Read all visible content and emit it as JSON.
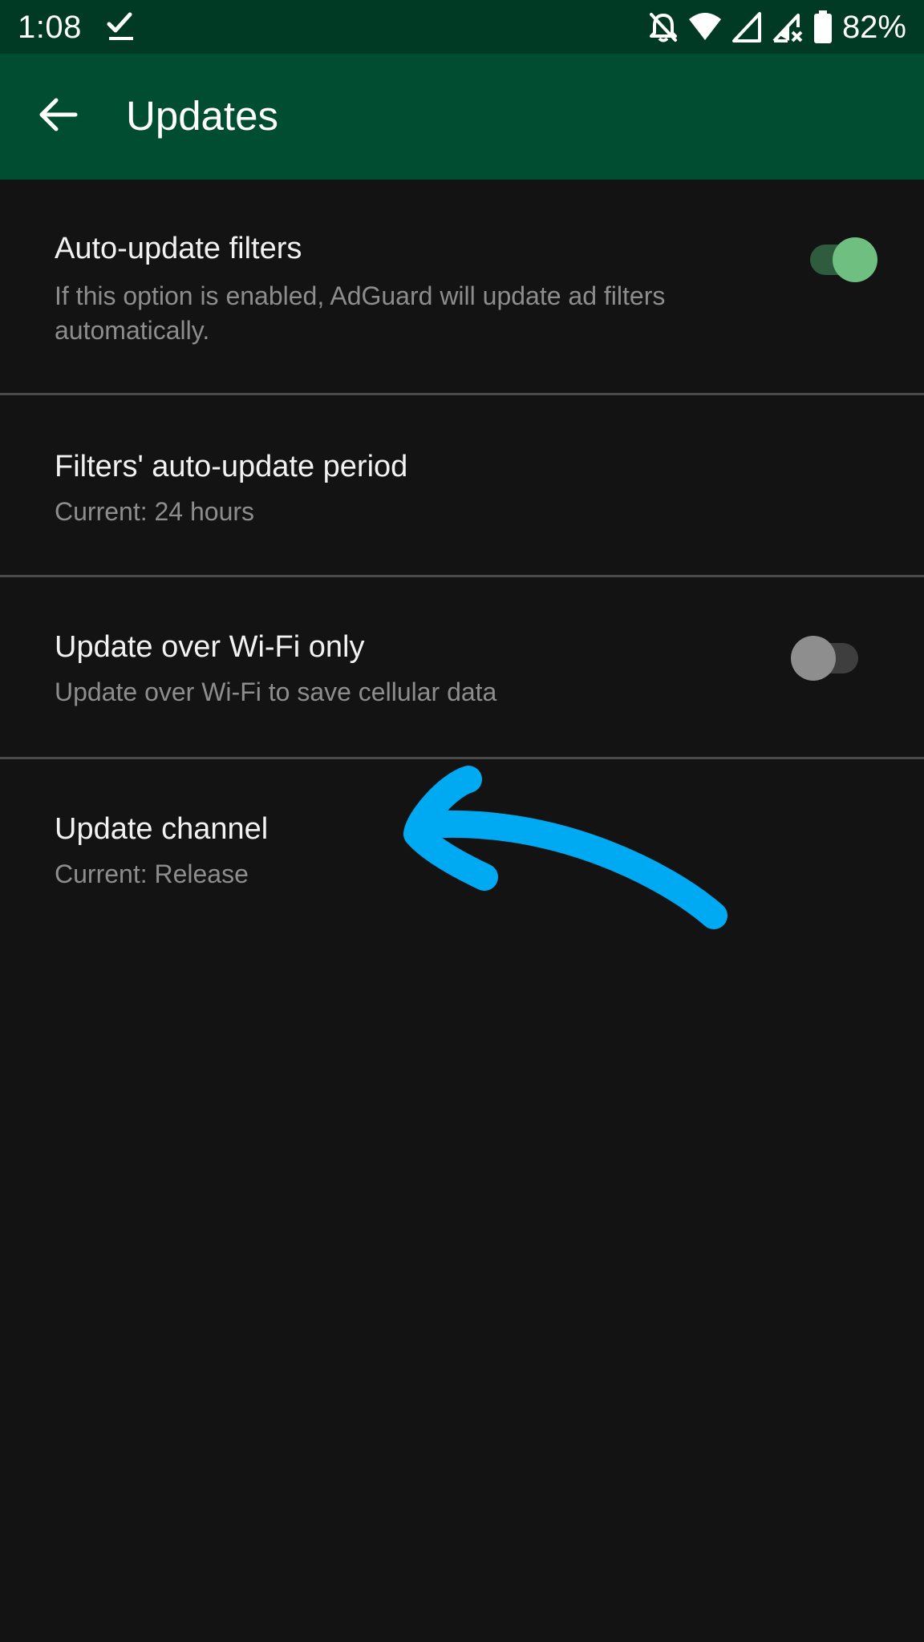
{
  "status_bar": {
    "time": "1:08",
    "battery": "82%",
    "icons": [
      "download-done-icon",
      "notifications-off-icon",
      "wifi-icon",
      "cell-signal-icon",
      "cell-signal-no-data-icon",
      "battery-icon"
    ]
  },
  "app_bar": {
    "back_icon": "arrow-back-icon",
    "title": "Updates"
  },
  "settings": [
    {
      "title": "Auto-update filters",
      "subtitle": "If this option is enabled, AdGuard will update ad filters automatically.",
      "toggle": true
    },
    {
      "title": "Filters' auto-update period",
      "subtitle": "Current: 24 hours"
    },
    {
      "title": "Update over Wi-Fi only",
      "subtitle": "Update over Wi-Fi to save cellular data",
      "toggle": false
    },
    {
      "title": "Update channel",
      "subtitle": "Current: Release"
    }
  ],
  "colors": {
    "status_bar": "#003a25",
    "app_bar": "#004d32",
    "background": "#131313",
    "toggle_on": "#6fbf80",
    "annotation": "#00aaf2"
  }
}
